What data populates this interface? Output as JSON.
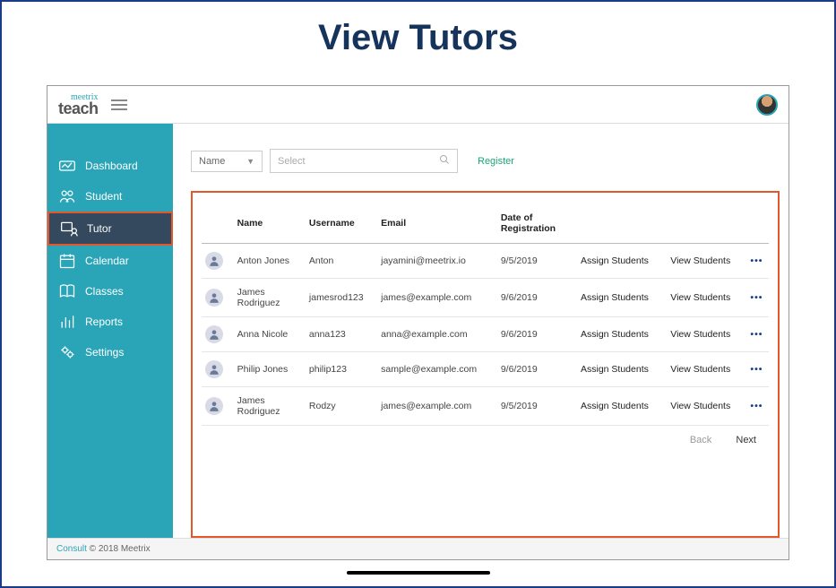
{
  "page_title": "View Tutors",
  "logo": {
    "top": "meetrix",
    "bottom": "teach"
  },
  "sidebar": {
    "items": [
      {
        "label": "Dashboard"
      },
      {
        "label": "Student"
      },
      {
        "label": "Tutor"
      },
      {
        "label": "Calendar"
      },
      {
        "label": "Classes"
      },
      {
        "label": "Reports"
      },
      {
        "label": "Settings"
      }
    ],
    "active_index": 2
  },
  "filter": {
    "dropdown_label": "Name",
    "search_placeholder": "Select",
    "register_label": "Register"
  },
  "table": {
    "headers": {
      "name": "Name",
      "username": "Username",
      "email": "Email",
      "date": "Date of Registration"
    },
    "actions": {
      "assign": "Assign Students",
      "view": "View Students"
    },
    "rows": [
      {
        "name": "Anton Jones",
        "username": "Anton",
        "email": "jayamini@meetrix.io",
        "date": "9/5/2019"
      },
      {
        "name": "James Rodriguez",
        "username": "jamesrod123",
        "email": "james@example.com",
        "date": "9/6/2019"
      },
      {
        "name": "Anna Nicole",
        "username": "anna123",
        "email": "anna@example.com",
        "date": "9/6/2019"
      },
      {
        "name": "Philip Jones",
        "username": "philip123",
        "email": "sample@example.com",
        "date": "9/6/2019"
      },
      {
        "name": "James Rodriguez",
        "username": "Rodzy",
        "email": "james@example.com",
        "date": "9/5/2019"
      }
    ]
  },
  "pager": {
    "back": "Back",
    "next": "Next"
  },
  "footer": {
    "link": "Consult",
    "rest": " © 2018 Meetrix"
  }
}
